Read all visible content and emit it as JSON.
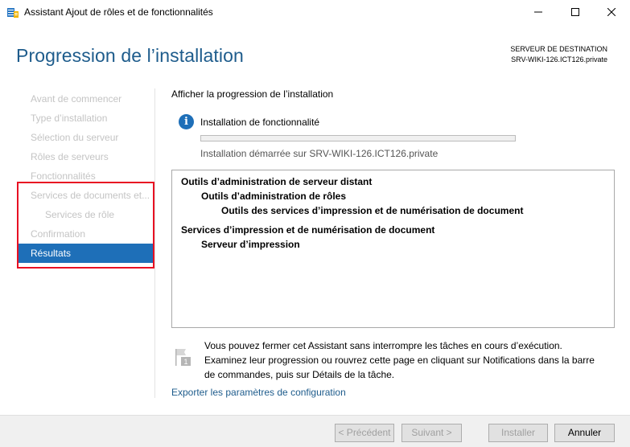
{
  "window": {
    "title": "Assistant Ajout de rôles et de fonctionnalités"
  },
  "header": {
    "page_title": "Progression de l’installation",
    "destination_label": "SERVEUR DE DESTINATION",
    "destination_server": "SRV-WIKI-126.ICT126.private"
  },
  "nav": {
    "items": [
      {
        "label": "Avant de commencer"
      },
      {
        "label": "Type d’installation"
      },
      {
        "label": "Sélection du serveur"
      },
      {
        "label": "Rôles de serveurs"
      },
      {
        "label": "Fonctionnalités"
      },
      {
        "label": "Services de documents et..."
      },
      {
        "label": "Services de rôle"
      },
      {
        "label": "Confirmation"
      },
      {
        "label": "Résultats"
      }
    ],
    "active_item": "Résultats"
  },
  "content": {
    "section_title": "Afficher la progression de l’installation",
    "install_status": "Installation de fonctionnalité",
    "progress_fraction": 0,
    "install_started": "Installation démarrée sur SRV-WIKI-126.ICT126.private",
    "features": [
      "Outils d’administration de serveur distant",
      "Outils d’administration de rôles",
      "Outils des services d’impression et de numérisation de document",
      "Services d’impression et de numérisation de document",
      "Serveur d’impression"
    ],
    "notice": "Vous pouvez fermer cet Assistant sans interrompre les tâches en cours d’exécution. Examinez leur progression ou rouvrez cette page en cliquant sur Notifications dans la barre de commandes, puis sur Détails de la tâche.",
    "export_link": "Exporter les paramètres de configuration"
  },
  "footer": {
    "prev_label": "< Précédent",
    "next_label": "Suivant >",
    "install_label": "Installer",
    "cancel_label": "Annuler"
  },
  "colors": {
    "accent": "#1e6fb8",
    "title": "#1e5c8c",
    "highlight_border": "#e81123"
  }
}
